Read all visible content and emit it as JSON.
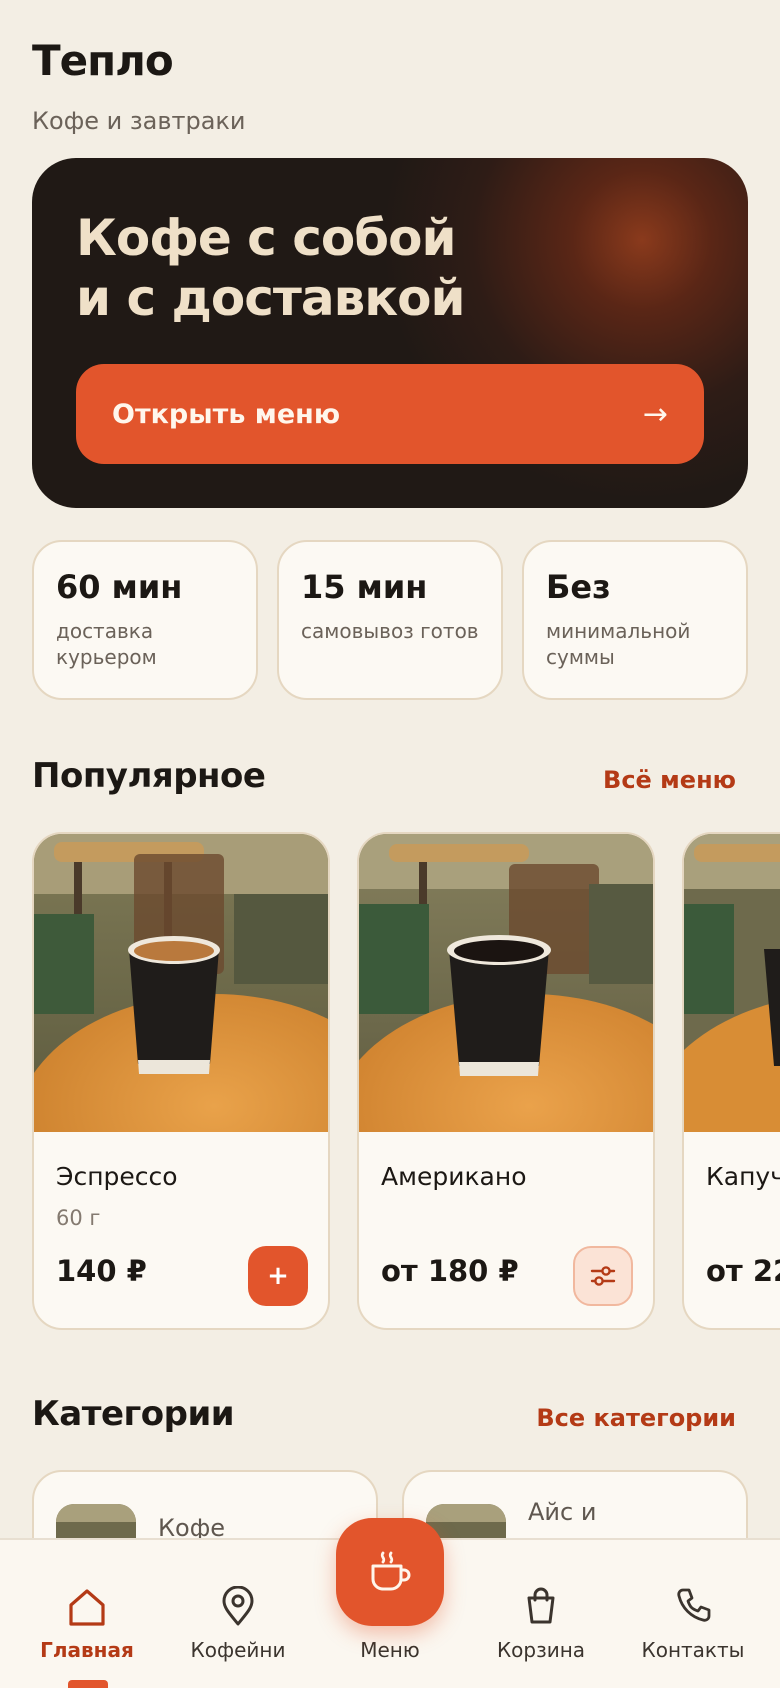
{
  "header": {
    "brand": "Тепло",
    "tagline": "Кофе и завтраки"
  },
  "hero": {
    "title": "Кофе с собой и с доставкой",
    "button_label": "Открыть меню",
    "button_arrow": "→"
  },
  "stats": [
    {
      "value": "60 мин",
      "caption": "доставка курьером"
    },
    {
      "value": "15 мин",
      "caption": "самовывоз готов"
    },
    {
      "value": "Без",
      "caption": "минимальной суммы"
    }
  ],
  "popular": {
    "title": "Популярное",
    "link": "Всё меню",
    "items": [
      {
        "name": "Эспрессо",
        "weight": "60 г",
        "price": "140 ₽",
        "action": "+",
        "action_icon": "plus-icon"
      },
      {
        "name": "Американо",
        "weight": "",
        "price": "от 180 ₽",
        "action_icon": "options-sliders-icon"
      },
      {
        "name": "Капуч",
        "weight": "",
        "price": "от 22"
      }
    ]
  },
  "categories": {
    "title": "Категории",
    "link": "Все категории",
    "items": [
      {
        "label": "Кофе"
      },
      {
        "label": "Айс и"
      }
    ]
  },
  "tabbar": {
    "items": [
      {
        "label": "Главная",
        "icon": "home-icon",
        "active": true
      },
      {
        "label": "Кофейни",
        "icon": "map-pin-icon"
      },
      {
        "label": "Меню",
        "icon": "coffee-cup-icon"
      },
      {
        "label": "Корзина",
        "icon": "shopping-bag-icon"
      },
      {
        "label": "Контакты",
        "icon": "phone-icon"
      }
    ]
  },
  "colors": {
    "accent": "#e2552c",
    "accent_text": "#b43a16",
    "background": "#f3eee4",
    "hero_bg": "#201915",
    "card_bg": "#fcf9f3"
  }
}
